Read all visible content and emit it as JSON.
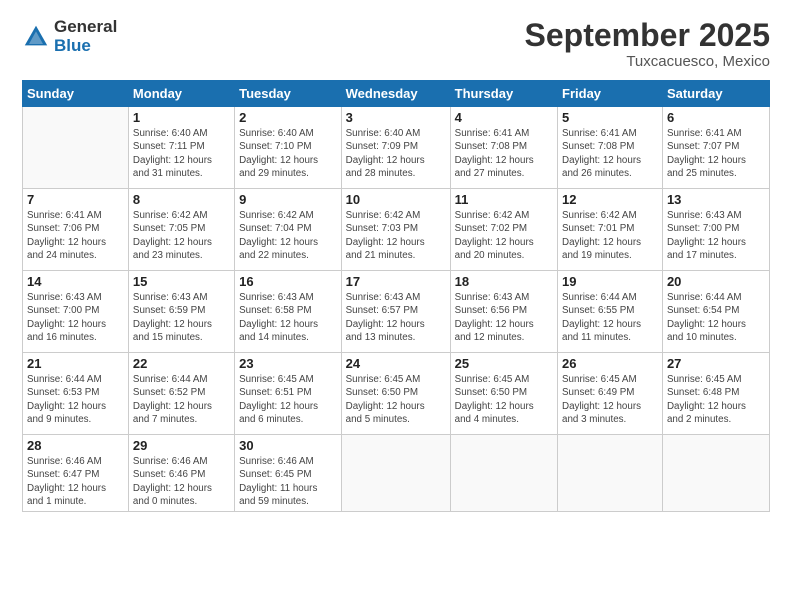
{
  "logo": {
    "general": "General",
    "blue": "Blue"
  },
  "title": {
    "month": "September 2025",
    "location": "Tuxcacuesco, Mexico"
  },
  "weekdays": [
    "Sunday",
    "Monday",
    "Tuesday",
    "Wednesday",
    "Thursday",
    "Friday",
    "Saturday"
  ],
  "weeks": [
    [
      {
        "day": "",
        "info": ""
      },
      {
        "day": "1",
        "info": "Sunrise: 6:40 AM\nSunset: 7:11 PM\nDaylight: 12 hours\nand 31 minutes."
      },
      {
        "day": "2",
        "info": "Sunrise: 6:40 AM\nSunset: 7:10 PM\nDaylight: 12 hours\nand 29 minutes."
      },
      {
        "day": "3",
        "info": "Sunrise: 6:40 AM\nSunset: 7:09 PM\nDaylight: 12 hours\nand 28 minutes."
      },
      {
        "day": "4",
        "info": "Sunrise: 6:41 AM\nSunset: 7:08 PM\nDaylight: 12 hours\nand 27 minutes."
      },
      {
        "day": "5",
        "info": "Sunrise: 6:41 AM\nSunset: 7:08 PM\nDaylight: 12 hours\nand 26 minutes."
      },
      {
        "day": "6",
        "info": "Sunrise: 6:41 AM\nSunset: 7:07 PM\nDaylight: 12 hours\nand 25 minutes."
      }
    ],
    [
      {
        "day": "7",
        "info": "Sunrise: 6:41 AM\nSunset: 7:06 PM\nDaylight: 12 hours\nand 24 minutes."
      },
      {
        "day": "8",
        "info": "Sunrise: 6:42 AM\nSunset: 7:05 PM\nDaylight: 12 hours\nand 23 minutes."
      },
      {
        "day": "9",
        "info": "Sunrise: 6:42 AM\nSunset: 7:04 PM\nDaylight: 12 hours\nand 22 minutes."
      },
      {
        "day": "10",
        "info": "Sunrise: 6:42 AM\nSunset: 7:03 PM\nDaylight: 12 hours\nand 21 minutes."
      },
      {
        "day": "11",
        "info": "Sunrise: 6:42 AM\nSunset: 7:02 PM\nDaylight: 12 hours\nand 20 minutes."
      },
      {
        "day": "12",
        "info": "Sunrise: 6:42 AM\nSunset: 7:01 PM\nDaylight: 12 hours\nand 19 minutes."
      },
      {
        "day": "13",
        "info": "Sunrise: 6:43 AM\nSunset: 7:00 PM\nDaylight: 12 hours\nand 17 minutes."
      }
    ],
    [
      {
        "day": "14",
        "info": "Sunrise: 6:43 AM\nSunset: 7:00 PM\nDaylight: 12 hours\nand 16 minutes."
      },
      {
        "day": "15",
        "info": "Sunrise: 6:43 AM\nSunset: 6:59 PM\nDaylight: 12 hours\nand 15 minutes."
      },
      {
        "day": "16",
        "info": "Sunrise: 6:43 AM\nSunset: 6:58 PM\nDaylight: 12 hours\nand 14 minutes."
      },
      {
        "day": "17",
        "info": "Sunrise: 6:43 AM\nSunset: 6:57 PM\nDaylight: 12 hours\nand 13 minutes."
      },
      {
        "day": "18",
        "info": "Sunrise: 6:43 AM\nSunset: 6:56 PM\nDaylight: 12 hours\nand 12 minutes."
      },
      {
        "day": "19",
        "info": "Sunrise: 6:44 AM\nSunset: 6:55 PM\nDaylight: 12 hours\nand 11 minutes."
      },
      {
        "day": "20",
        "info": "Sunrise: 6:44 AM\nSunset: 6:54 PM\nDaylight: 12 hours\nand 10 minutes."
      }
    ],
    [
      {
        "day": "21",
        "info": "Sunrise: 6:44 AM\nSunset: 6:53 PM\nDaylight: 12 hours\nand 9 minutes."
      },
      {
        "day": "22",
        "info": "Sunrise: 6:44 AM\nSunset: 6:52 PM\nDaylight: 12 hours\nand 7 minutes."
      },
      {
        "day": "23",
        "info": "Sunrise: 6:45 AM\nSunset: 6:51 PM\nDaylight: 12 hours\nand 6 minutes."
      },
      {
        "day": "24",
        "info": "Sunrise: 6:45 AM\nSunset: 6:50 PM\nDaylight: 12 hours\nand 5 minutes."
      },
      {
        "day": "25",
        "info": "Sunrise: 6:45 AM\nSunset: 6:50 PM\nDaylight: 12 hours\nand 4 minutes."
      },
      {
        "day": "26",
        "info": "Sunrise: 6:45 AM\nSunset: 6:49 PM\nDaylight: 12 hours\nand 3 minutes."
      },
      {
        "day": "27",
        "info": "Sunrise: 6:45 AM\nSunset: 6:48 PM\nDaylight: 12 hours\nand 2 minutes."
      }
    ],
    [
      {
        "day": "28",
        "info": "Sunrise: 6:46 AM\nSunset: 6:47 PM\nDaylight: 12 hours\nand 1 minute."
      },
      {
        "day": "29",
        "info": "Sunrise: 6:46 AM\nSunset: 6:46 PM\nDaylight: 12 hours\nand 0 minutes."
      },
      {
        "day": "30",
        "info": "Sunrise: 6:46 AM\nSunset: 6:45 PM\nDaylight: 11 hours\nand 59 minutes."
      },
      {
        "day": "",
        "info": ""
      },
      {
        "day": "",
        "info": ""
      },
      {
        "day": "",
        "info": ""
      },
      {
        "day": "",
        "info": ""
      }
    ]
  ]
}
